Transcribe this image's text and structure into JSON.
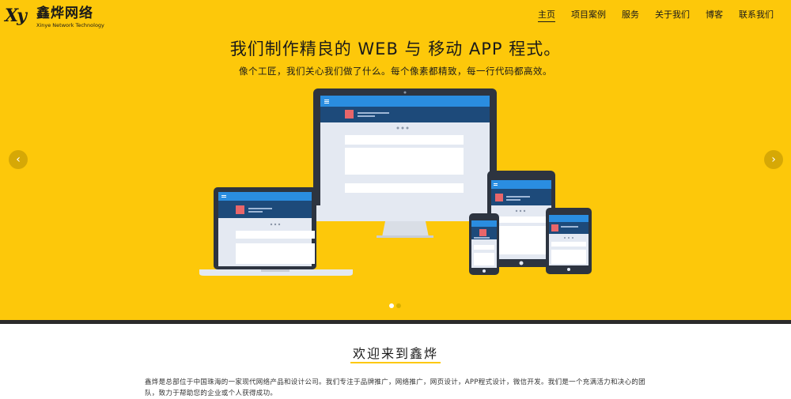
{
  "brand": {
    "mark": "Xy",
    "name": "鑫烨网络",
    "sub": "Xinye Network Technology"
  },
  "nav": [
    {
      "label": "主页",
      "active": true
    },
    {
      "label": "项目案例"
    },
    {
      "label": "服务"
    },
    {
      "label": "关于我们"
    },
    {
      "label": "博客"
    },
    {
      "label": "联系我们"
    }
  ],
  "hero": {
    "title": "我们制作精良的 WEB 与 移动 APP 程式。",
    "subtitle": "像个工匠，我们关心我们做了什么。每个像素都精致，每一行代码都高效。",
    "prev_icon": "chevron-left-icon",
    "next_icon": "chevron-right-icon",
    "prev_glyph": "‹",
    "next_glyph": "›",
    "slides": 2,
    "active_slide": 0
  },
  "welcome": {
    "title": "欢迎来到鑫烨",
    "text": "鑫烨是总部位于中国珠海的一家现代网络产品和设计公司。我们专注于品牌推广，网络推广，网页设计，APP程式设计，微信开发。我们是一个充满活力和决心的团队，致力于帮助您的企业或个人获得成功。"
  },
  "colors": {
    "accent": "#fdc80a",
    "dark": "#2b2b2b",
    "screen_blue": "#2a8de0",
    "screen_navy": "#1d4a7a",
    "thumb_red": "#e8666a"
  }
}
